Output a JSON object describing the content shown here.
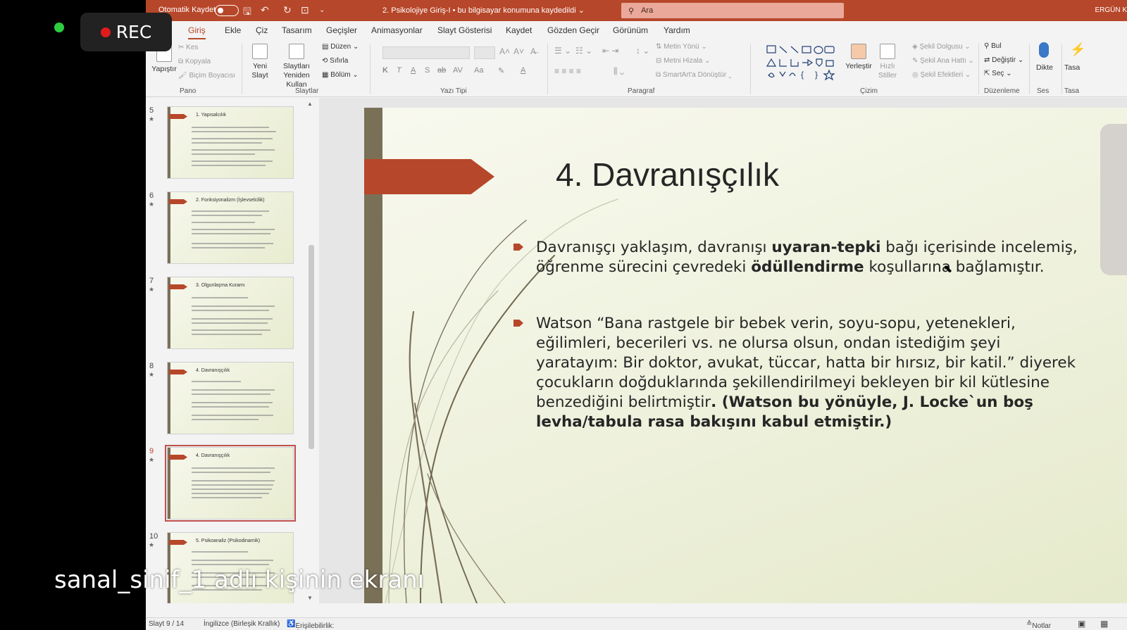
{
  "recording": {
    "label": "REC"
  },
  "titlebar": {
    "autosave": "Otomatik Kaydet",
    "document": "2. Psikolojiye Giriş-I • bu bilgisayar konumuna kaydedildi ⌄",
    "search_placeholder": "Ara",
    "user": "ERGÜN K"
  },
  "tabs": [
    "a",
    "Giriş",
    "Ekle",
    "Çiz",
    "Tasarım",
    "Geçişler",
    "Animasyonlar",
    "Slayt Gösterisi",
    "Kaydet",
    "Gözden Geçir",
    "Görünüm",
    "Yardım"
  ],
  "ribbon": {
    "groups": [
      "Pano",
      "Slaytlar",
      "Yazı Tipi",
      "Paragraf",
      "Çizim",
      "Düzenleme",
      "Ses",
      "Tasa"
    ],
    "pano": {
      "paste": "Yapıştır",
      "cut": "Kes",
      "copy": "Kopyala",
      "format_painter": "Biçim Boyacısı"
    },
    "slides": {
      "new_slide_1": "Yeni",
      "new_slide_2": "Slayt",
      "reuse_1": "Slaytları",
      "reuse_2": "Yeniden Kullan",
      "layout": "Düzen",
      "reset": "Sıfırla",
      "section": "Bölüm"
    },
    "paragraph": {
      "text_direction": "Metin Yönü",
      "align_text": "Metni Hizala",
      "smartart": "SmartArt'a Dönüştür"
    },
    "drawing": {
      "arrange": "Yerleştir",
      "quick_styles_1": "Hızlı",
      "quick_styles_2": "Stiller",
      "fill": "Şekil Dolgusu",
      "outline": "Şekil Ana Hattı",
      "effects": "Şekil Efektleri"
    },
    "editing": {
      "find": "Bul",
      "replace": "Değiştir",
      "select": "Seç"
    },
    "voice": {
      "dictate": "Dikte"
    },
    "designer": {
      "label": "Tasa"
    },
    "format_buttons": [
      "K",
      "T",
      "A",
      "S",
      "ab",
      "AV",
      "Aa"
    ]
  },
  "thumbnails": [
    {
      "num": "5",
      "title": "1. Yapısalcılık",
      "selected": false
    },
    {
      "num": "6",
      "title": "2. Fonksiyonalizm (İşlevselcilik)",
      "selected": false
    },
    {
      "num": "7",
      "title": "3. Olgunlaşma Kuramı",
      "selected": false
    },
    {
      "num": "8",
      "title": "4. Davranışçılık",
      "selected": false
    },
    {
      "num": "9",
      "title": "4. Davranışçılık",
      "selected": true
    },
    {
      "num": "10",
      "title": "5. Psikoanaliz (Psikodinamik)",
      "selected": false
    }
  ],
  "slide": {
    "title": "4. Davranışçılık",
    "p1": {
      "t1": "Davranışçı yaklaşım, davranışı ",
      "b1": "uyaran-tepki",
      "t2": " bağı içerisinde incelemiş, öğrenme sürecini çevredeki ",
      "b2": "ödüllendirme",
      "t3": " koşullarına bağlamıştır."
    },
    "p2": {
      "t1": "Watson “Bana rastgele bir bebek verin, soyu-sopu, yetenekleri, eğilimleri, becerileri vs. ne olursa olsun, ondan istediğim şeyi yaratayım: Bir doktor, avukat, tüccar, hatta bir hırsız, bir katil.” diyerek çocukların doğduklarında şekillendirilmeyi bekleyen bir kil kütlesine benzediğini belirtmiştir",
      "b1": ". (Watson bu yönüyle, J. Locke`un boş levha/tabula rasa bakışını kabul etmiştir.)"
    }
  },
  "overlay": {
    "name": "sanal_sinif_1 adlı kişinin ekranı"
  },
  "statusbar": {
    "slide_count": "Slayt 9 / 14",
    "language": "İngilizce (Birleşik Krallık)",
    "accessibility": "Erişilebilirlik: Önerilere göz atın",
    "notes": "Notlar"
  },
  "colors": {
    "accent": "#b7472a",
    "slide_bar": "#7a7058",
    "rec_dot": "#e01b1b",
    "online_dot": "#2ecc40"
  }
}
